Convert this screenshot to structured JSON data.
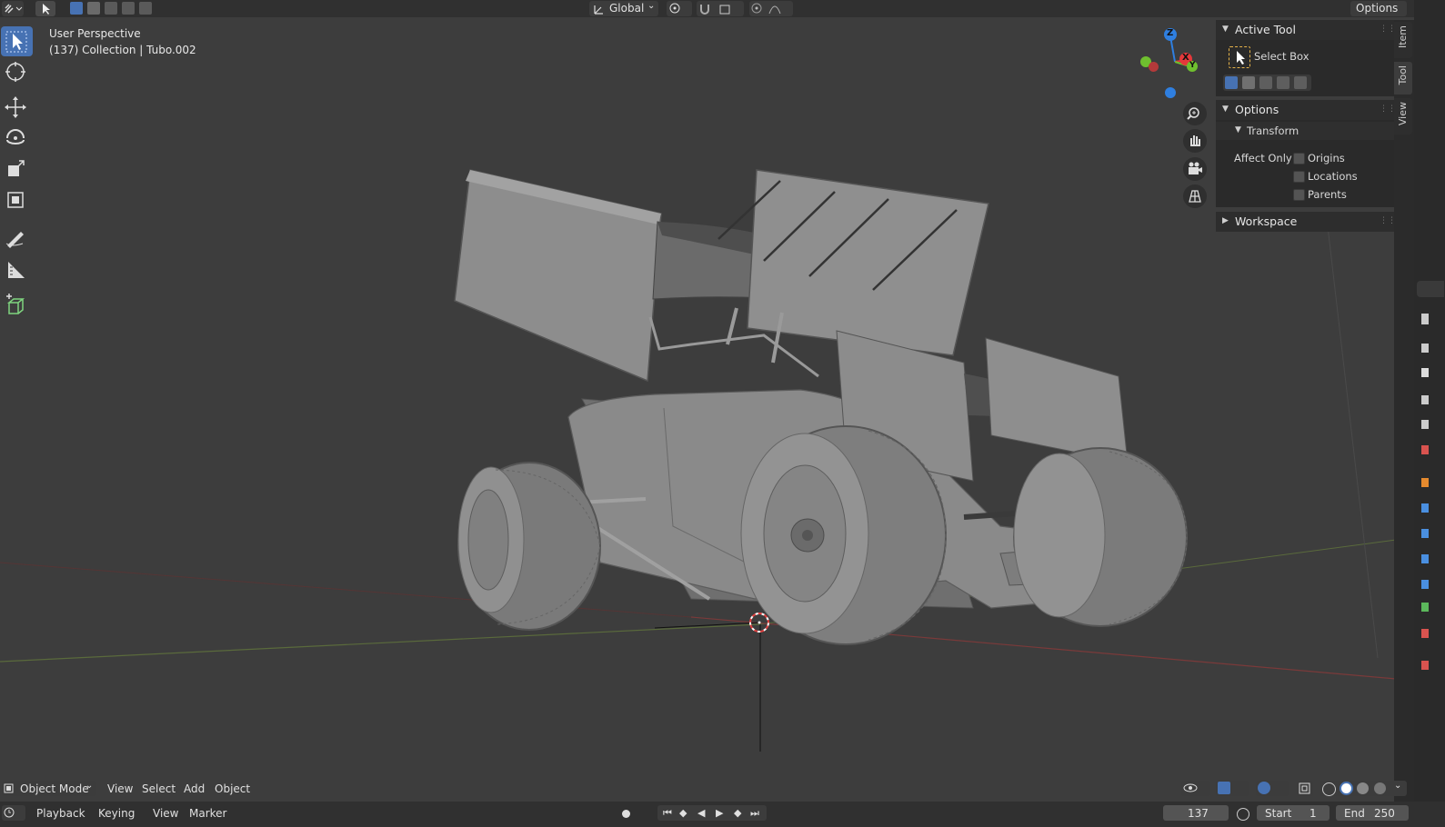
{
  "topbar": {
    "transform_orientation": "Global",
    "options_label": "Options"
  },
  "viewport": {
    "view_name": "User Perspective",
    "collection_info": "(137) Collection | Tubo.002"
  },
  "gizmo": {
    "z_label": "Z",
    "x_label": "X",
    "y_label": "Y"
  },
  "npanel": {
    "active_tool_title": "Active Tool",
    "tool_name": "Select Box",
    "options_title": "Options",
    "transform_title": "Transform",
    "affect_only_label": "Affect Only",
    "affect": [
      "Origins",
      "Locations",
      "Parents"
    ],
    "workspace_title": "Workspace",
    "tabs": [
      "Item",
      "Tool",
      "View"
    ]
  },
  "viewport_header": {
    "mode": "Object Mode",
    "menus": [
      "View",
      "Select",
      "Add",
      "Object"
    ]
  },
  "timeline": {
    "menus": [
      "Playback",
      "Keying",
      "View",
      "Marker"
    ],
    "current_frame": "137",
    "start_label": "Start",
    "start_value": "1",
    "end_label": "End",
    "end_value": "250"
  },
  "colors": {
    "accent": "#4772b3",
    "axis_x": "#e5383b",
    "axis_y": "#6fbf2f",
    "axis_z": "#2f7fe0"
  }
}
